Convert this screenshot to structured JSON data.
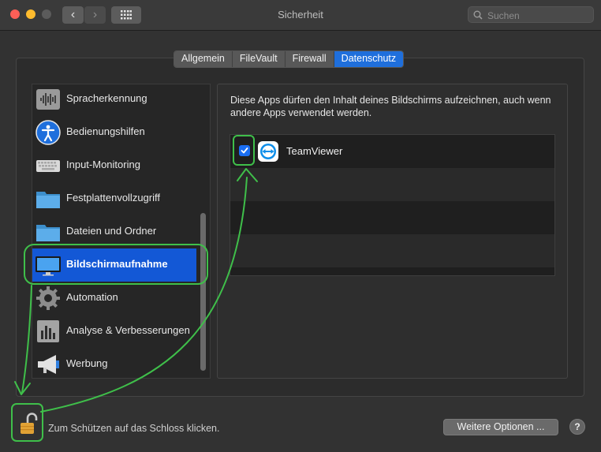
{
  "window": {
    "title": "Sicherheit"
  },
  "toolbar": {
    "back_symbol": "‹",
    "forward_symbol": "›",
    "search_placeholder": "Suchen"
  },
  "tabs": [
    {
      "label": "Allgemein",
      "active": false
    },
    {
      "label": "FileVault",
      "active": false
    },
    {
      "label": "Firewall",
      "active": false
    },
    {
      "label": "Datenschutz",
      "active": true
    }
  ],
  "categories": [
    {
      "label": "Spracherkennung",
      "icon": "waveform-icon"
    },
    {
      "label": "Bedienungshilfen",
      "icon": "accessibility-icon"
    },
    {
      "label": "Input-Monitoring",
      "icon": "keyboard-icon"
    },
    {
      "label": "Festplattenvollzugriff",
      "icon": "folder-icon"
    },
    {
      "label": "Dateien und Ordner",
      "icon": "folder-icon"
    },
    {
      "label": "Bildschirmaufnahme",
      "icon": "display-icon",
      "selected": true
    },
    {
      "label": "Automation",
      "icon": "gear-icon"
    },
    {
      "label": "Analyse & Verbesserungen",
      "icon": "bar-chart-icon"
    },
    {
      "label": "Werbung",
      "icon": "megaphone-icon"
    }
  ],
  "detail": {
    "description": "Diese Apps dürfen den Inhalt deines Bildschirms aufzeichnen, auch wenn andere Apps verwendet werden.",
    "apps": [
      {
        "name": "TeamViewer",
        "checked": true,
        "icon": "teamviewer-icon"
      }
    ]
  },
  "footer": {
    "lock_message": "Zum Schützen auf das Schloss klicken.",
    "more_options_label": "Weitere Optionen ...",
    "help_label": "?"
  },
  "colors": {
    "accent": "#1f6fdc",
    "selection": "#1358d6",
    "annotation": "#3fbf4a"
  }
}
